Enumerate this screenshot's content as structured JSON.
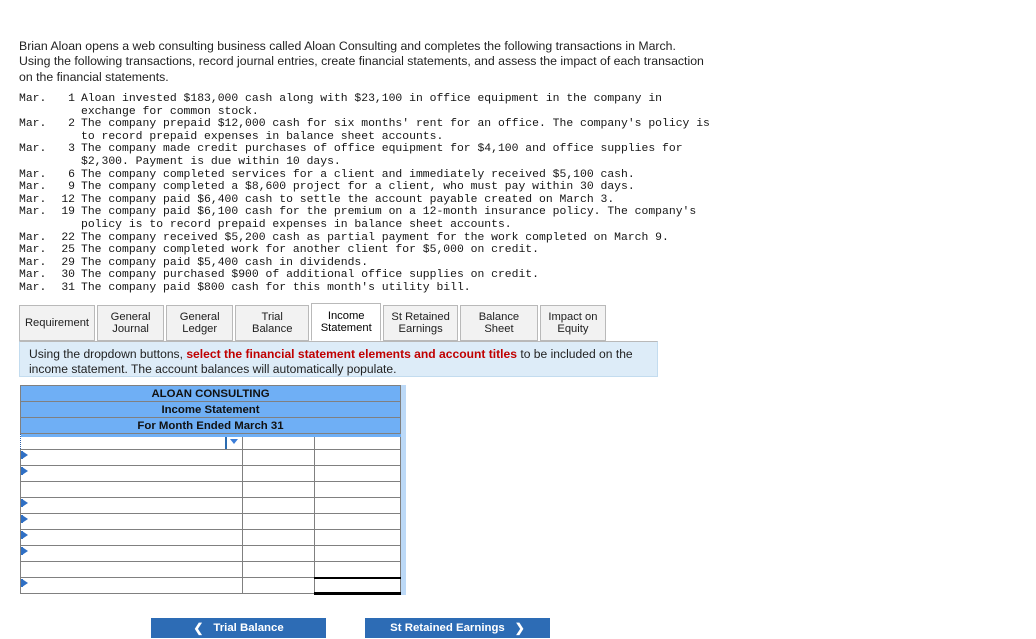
{
  "intro": {
    "line1": "Brian Aloan opens a web consulting business called Aloan Consulting and completes the following transactions in March.",
    "line2": "Using the following transactions, record journal entries, create financial statements, and assess the impact of each transaction on the financial statements."
  },
  "transactions": [
    {
      "month": "Mar.",
      "day": "1",
      "text": "Aloan invested $183,000 cash along with $23,100 in office equipment in the company in exchange for common stock."
    },
    {
      "month": "Mar.",
      "day": "2",
      "text": "The company prepaid $12,000 cash for six months' rent for an office. The company's policy is to record prepaid expenses in balance sheet accounts."
    },
    {
      "month": "Mar.",
      "day": "3",
      "text": "The company made credit purchases of office equipment for $4,100 and office supplies for $2,300. Payment is due within 10 days."
    },
    {
      "month": "Mar.",
      "day": "6",
      "text": "The company completed services for a client and immediately received $5,100 cash."
    },
    {
      "month": "Mar.",
      "day": "9",
      "text": "The company completed a $8,600 project for a client, who must pay within 30 days."
    },
    {
      "month": "Mar.",
      "day": "12",
      "text": "The company paid $6,400 cash to settle the account payable created on March 3."
    },
    {
      "month": "Mar.",
      "day": "19",
      "text": "The company paid $6,100 cash for the premium on a 12-month insurance policy. The company's policy is to record prepaid expenses in balance sheet accounts."
    },
    {
      "month": "Mar.",
      "day": "22",
      "text": "The company received $5,200 cash as partial payment for the work completed on March 9."
    },
    {
      "month": "Mar.",
      "day": "25",
      "text": "The company completed work for another client for $5,000 on credit."
    },
    {
      "month": "Mar.",
      "day": "29",
      "text": "The company paid $5,400 cash in dividends."
    },
    {
      "month": "Mar.",
      "day": "30",
      "text": "The company purchased $900 of additional office supplies on credit."
    },
    {
      "month": "Mar.",
      "day": "31",
      "text": "The company paid $800 cash for this month's utility bill."
    }
  ],
  "tabs": [
    {
      "label": "Requirement",
      "line1": "Requirement",
      "line2": "",
      "active": false,
      "width": 76
    },
    {
      "label": "General Journal",
      "line1": "General",
      "line2": "Journal",
      "active": false,
      "width": 69
    },
    {
      "label": "General Ledger",
      "line1": "General",
      "line2": "Ledger",
      "active": false,
      "width": 69
    },
    {
      "label": "Trial Balance",
      "line1": "Trial Balance",
      "line2": "",
      "active": false,
      "width": 76
    },
    {
      "label": "Income Statement",
      "line1": "Income",
      "line2": "Statement",
      "active": true,
      "width": 72
    },
    {
      "label": "St Retained Earnings",
      "line1": "St Retained",
      "line2": "Earnings",
      "active": false,
      "width": 77
    },
    {
      "label": "Balance Sheet",
      "line1": "Balance Sheet",
      "line2": "",
      "active": false,
      "width": 80
    },
    {
      "label": "Impact on Equity",
      "line1": "Impact on",
      "line2": "Equity",
      "active": false,
      "width": 68
    }
  ],
  "banner": {
    "pre": "Using the dropdown buttons, ",
    "highlight": "select the financial statement elements and account titles",
    "post": " to be included on the income statement. The account balances will automatically populate."
  },
  "statement": {
    "title_line1": "ALOAN CONSULTING",
    "title_line2": "Income Statement",
    "title_line3": "For Month Ended March 31",
    "selected_row": {
      "description": "",
      "amount_a": "",
      "amount_b": "",
      "dropdown_open": false
    },
    "rows": [
      {
        "description": "",
        "amount_a": "",
        "amount_b": "",
        "marker": true,
        "total": false
      },
      {
        "description": "",
        "amount_a": "",
        "amount_b": "",
        "marker": true,
        "total": false
      },
      {
        "description": "",
        "amount_a": "",
        "amount_b": "",
        "marker": false,
        "total": false
      },
      {
        "description": "",
        "amount_a": "",
        "amount_b": "",
        "marker": true,
        "total": false
      },
      {
        "description": "",
        "amount_a": "",
        "amount_b": "",
        "marker": true,
        "total": false
      },
      {
        "description": "",
        "amount_a": "",
        "amount_b": "",
        "marker": true,
        "total": false
      },
      {
        "description": "",
        "amount_a": "",
        "amount_b": "",
        "marker": true,
        "total": false
      },
      {
        "description": "",
        "amount_a": "",
        "amount_b": "",
        "marker": false,
        "total": false
      },
      {
        "description": "",
        "amount_a": "",
        "amount_b": "",
        "marker": true,
        "total": true
      }
    ]
  },
  "nav": {
    "prev_label": "Trial Balance",
    "prev_icon": "chevron-left-icon",
    "next_label": "St Retained Earnings",
    "next_icon": "chevron-right-icon"
  },
  "colors": {
    "header_blue": "#6faff5",
    "button_blue": "#2d6cb5",
    "banner_blue": "#ddecf8",
    "highlight_red": "#c00000",
    "gutter_blue": "#bcd9f7"
  }
}
